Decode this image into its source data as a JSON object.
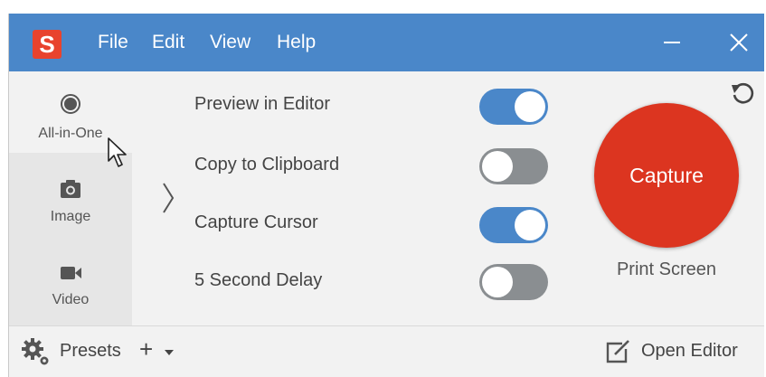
{
  "app": {
    "logo_letter": "S"
  },
  "menu": {
    "file": "File",
    "edit": "Edit",
    "view": "View",
    "help": "Help"
  },
  "sidebar": {
    "items": [
      {
        "label": "All-in-One",
        "icon": "record-dot-icon",
        "active": true
      },
      {
        "label": "Image",
        "icon": "camera-icon",
        "active": false
      },
      {
        "label": "Video",
        "icon": "video-camera-icon",
        "active": false
      }
    ]
  },
  "options": [
    {
      "label": "Preview in Editor",
      "on": true
    },
    {
      "label": "Copy to Clipboard",
      "on": false
    },
    {
      "label": "Capture Cursor",
      "on": true
    },
    {
      "label": "5 Second Delay",
      "on": false
    }
  ],
  "capture": {
    "button_label": "Capture",
    "hotkey": "Print Screen"
  },
  "bottom": {
    "presets_label": "Presets",
    "add_label": "+",
    "open_editor_label": "Open Editor"
  },
  "colors": {
    "titlebar": "#4a87c9",
    "capture": "#dc3520",
    "toggle_on": "#4a87c9",
    "toggle_off": "#8a8e91",
    "logo": "#e8432e"
  }
}
